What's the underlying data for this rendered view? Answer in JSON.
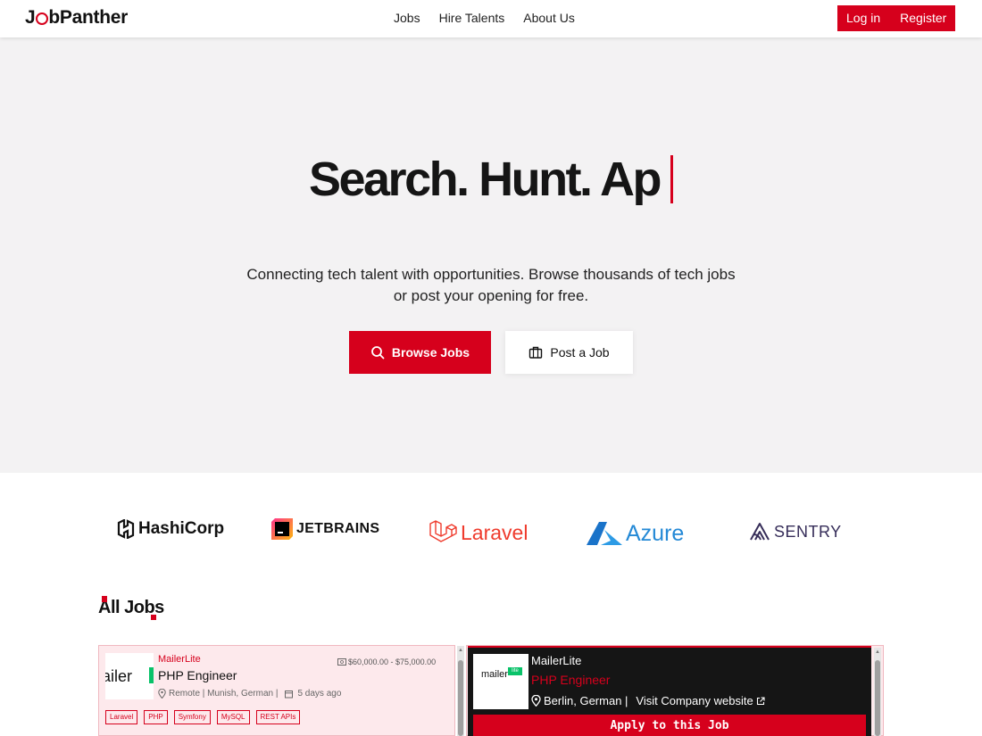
{
  "nav": {
    "logo_prefix": "J",
    "logo_suffix": "bPanther",
    "links": [
      "Jobs",
      "Hire Talents",
      "About Us"
    ],
    "login": "Log in",
    "register": "Register"
  },
  "hero": {
    "title": "Search. Hunt. Ap",
    "subtitle_line1": "Connecting tech talent with opportunities. Browse thousands of tech jobs",
    "subtitle_line2": "or post your opening for free.",
    "browse_button": "Browse Jobs",
    "post_button": "Post a Job"
  },
  "brands": [
    "HashiCorp",
    "JETBRAINS",
    "Laravel",
    "Azure",
    "SENTRY"
  ],
  "jobs_section": {
    "title": "All Jobs"
  },
  "job_card": {
    "logo_text": "ailer",
    "company": "MailerLite",
    "title": "PHP Engineer",
    "salary": "$60,000.00 - $75,000.00",
    "location": "Remote | Munish, German |",
    "posted": "5 days ago",
    "tags": [
      "Laravel",
      "PHP",
      "Symfony",
      "MySQL",
      "REST APIs"
    ]
  },
  "job_detail": {
    "logo_text": "mailer",
    "logo_badge": "lite",
    "company": "MailerLite",
    "title": "PHP Engineer",
    "location": "Berlin, German |",
    "website": "Visit Company website",
    "apply": "Apply to this Job"
  },
  "colors": {
    "accent": "#d6001c",
    "hero_bg": "#f3f2f3",
    "card_bg": "#fde9ec",
    "detail_bg": "#151515"
  }
}
